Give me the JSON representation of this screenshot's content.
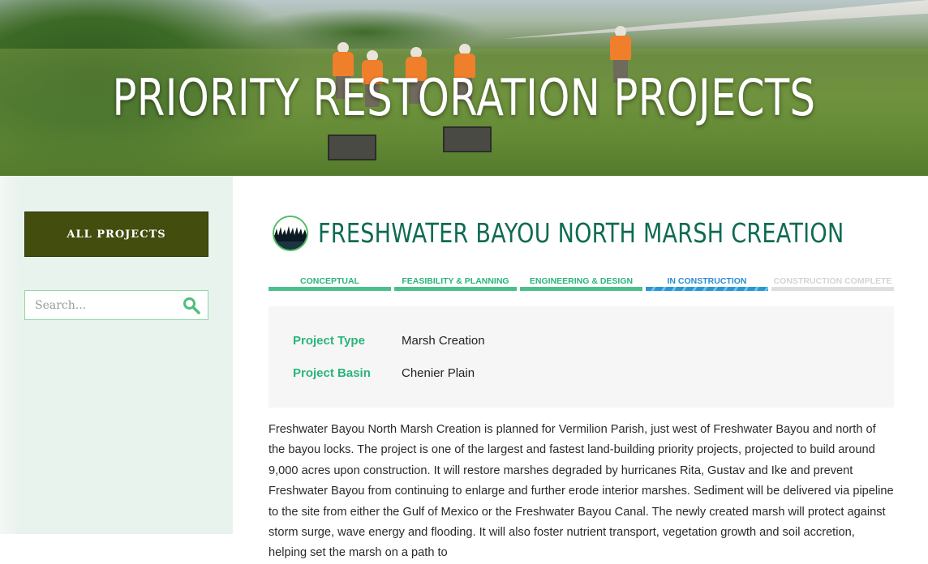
{
  "hero": {
    "title": "PRIORITY RESTORATION PROJECTS"
  },
  "sidebar": {
    "all_projects_label": "ALL PROJECTS",
    "search_placeholder": "Search..."
  },
  "project": {
    "title": "FRESHWATER BAYOU NORTH MARSH CREATION",
    "stages": [
      {
        "label": "CONCEPTUAL",
        "state": "done"
      },
      {
        "label": "FEASIBILITY & PLANNING",
        "state": "done"
      },
      {
        "label": "ENGINEERING & DESIGN",
        "state": "done"
      },
      {
        "label": "IN CONSTRUCTION",
        "state": "current"
      },
      {
        "label": "CONSTRUCTION COMPLETE",
        "state": "future"
      }
    ],
    "info": {
      "type_label": "Project Type",
      "type_value": "Marsh Creation",
      "basin_label": "Project Basin",
      "basin_value": "Chenier Plain"
    },
    "description": "Freshwater Bayou North Marsh Creation is planned for Vermilion Parish, just west of Freshwater Bayou and north of the bayou locks. The project is one of the largest and fastest land-building priority projects, projected to build around 9,000 acres upon construction. It will restore marshes degraded by hurricanes Rita, Gustav and Ike and prevent Freshwater Bayou from continuing to enlarge and further erode interior marshes. Sediment will be delivered via pipeline to the site from either the Gulf of Mexico or the Freshwater Bayou Canal. The newly created marsh will protect against storm surge, wave energy and flooding. It will also foster nutrient transport, vegetation growth and soil accretion, helping set the marsh on a path to"
  },
  "colors": {
    "accent_green": "#2ab57a",
    "title_green": "#0f6b52",
    "button_olive": "#424d0e",
    "in_progress_blue": "#2a97d6",
    "sidebar_bg": "#e9f3ee"
  },
  "icons": {
    "search": "search-icon",
    "project": "marsh-photo-icon"
  }
}
